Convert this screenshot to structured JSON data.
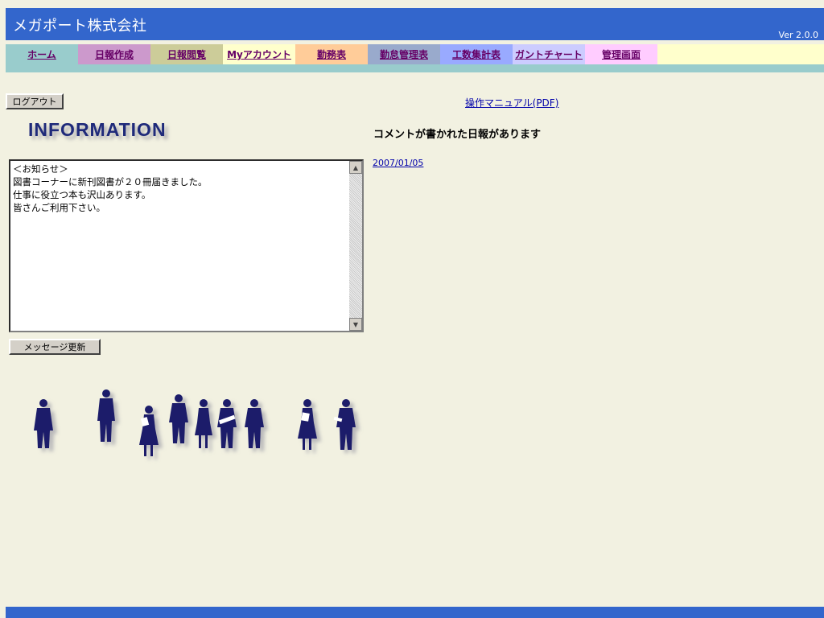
{
  "header": {
    "company_name": "メガポート株式会社",
    "version": "Ver 2.0.0",
    "bg_color": "#3366cc"
  },
  "nav": {
    "items": [
      {
        "label": "ホーム",
        "color": "#99cccc"
      },
      {
        "label": "日報作成",
        "color": "#cc99cc"
      },
      {
        "label": "日報閲覧",
        "color": "#cccc99"
      },
      {
        "label": "Myアカウント",
        "color": "#ffffcc"
      },
      {
        "label": "勤務表",
        "color": "#ffcc99"
      },
      {
        "label": "勤怠管理表",
        "color": "#99aacc"
      },
      {
        "label": "工数集計表",
        "color": "#99aaff"
      },
      {
        "label": "ガントチャート",
        "color": "#ccccff"
      },
      {
        "label": "管理画面",
        "color": "#ffccff"
      }
    ]
  },
  "logout_button": "ログアウト",
  "manual_link": "操作マニュアル(PDF)",
  "information_logo": "INFORMATION",
  "notice_text": "＜お知らせ＞\n図書コーナーに新刊図書が２０冊届きました。\n仕事に役立つ本も沢山あります。\n皆さんご利用下さい。",
  "update_button": "メッセージ更新",
  "comment_heading": "コメントが書かれた日報があります",
  "comment_dates": [
    "2007/01/05"
  ],
  "icons": {
    "scroll_up": "▲",
    "scroll_down": "▼"
  }
}
